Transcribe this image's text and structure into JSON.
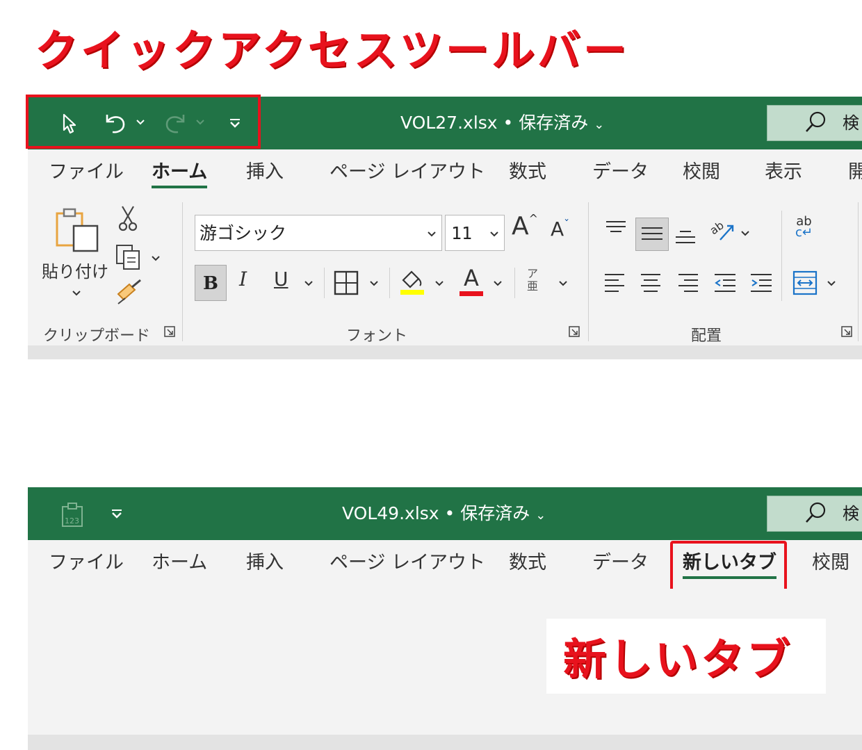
{
  "annotation": {
    "qat_title": "クイックアクセスツールバー",
    "newtab_title": "新しいタブ"
  },
  "window1": {
    "doc_title": "VOL27.xlsx • 保存済み",
    "search_text": "検",
    "tabs": [
      "ファイル",
      "ホーム",
      "挿入",
      "ページ レイアウト",
      "数式",
      "データ",
      "校閲",
      "表示",
      "開"
    ],
    "active_tab": "ホーム",
    "ribbon": {
      "clipboard": {
        "paste_label": "貼り付け",
        "group_label": "クリップボード"
      },
      "font": {
        "font_name": "游ゴシック",
        "font_size": "11",
        "bold": "B",
        "italic": "I",
        "underline": "U",
        "grow_font": "A",
        "shrink_font": "A",
        "font_color": "A",
        "phonetic_top": "ア",
        "phonetic_bottom": "亜",
        "group_label": "フォント"
      },
      "alignment": {
        "wrap_text": "ab",
        "group_label": "配置"
      }
    }
  },
  "window2": {
    "doc_title": "VOL49.xlsx • 保存済み",
    "search_text": "検",
    "tabs": [
      "ファイル",
      "ホーム",
      "挿入",
      "ページ レイアウト",
      "数式",
      "データ",
      "新しいタブ",
      "校閲"
    ],
    "active_tab": "新しいタブ"
  },
  "colors": {
    "excel_green": "#217346",
    "annotation_red": "#e8121d",
    "ribbon_bg": "#f3f3f3",
    "highlight_yellow": "#ffff00",
    "font_color_red": "#e8121d"
  },
  "icons": [
    "touch-mode-icon",
    "undo-icon",
    "redo-icon",
    "customize-qat-icon",
    "search-icon",
    "paste-icon",
    "cut-icon",
    "copy-icon",
    "format-painter-icon",
    "borders-icon",
    "fill-color-icon",
    "orientation-icon",
    "wrap-text-icon",
    "merge-center-icon",
    "number-format-icon"
  ]
}
